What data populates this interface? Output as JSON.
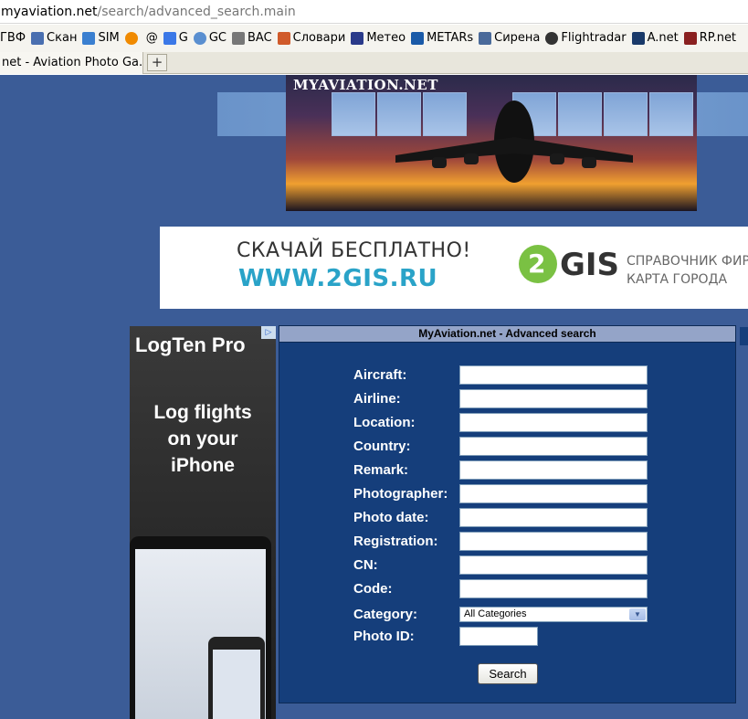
{
  "browser": {
    "url_host": "myaviation.net",
    "url_path": "/search/advanced_search.main",
    "bookmarks": [
      {
        "label": "ГВФ",
        "icon": "none",
        "color": "#ffffff"
      },
      {
        "label": "Скан",
        "icon": "eye-icon",
        "color": "#4a6fb0"
      },
      {
        "label": "SIM",
        "icon": "plane-icon",
        "color": "#3a7fd0"
      },
      {
        "label": "",
        "icon": "orange-circle-icon",
        "color": "#f08a00"
      },
      {
        "label": "@",
        "icon": "none",
        "color": "#ffffff"
      },
      {
        "label": "G",
        "icon": "google-icon",
        "color": "#3b78e7"
      },
      {
        "label": "GC",
        "icon": "globe-icon",
        "color": "#5a8fd0"
      },
      {
        "label": "BAC",
        "icon": "plane-icon",
        "color": "#777777"
      },
      {
        "label": "Словари",
        "icon": "chart-icon",
        "color": "#d05a2a"
      },
      {
        "label": "Метео",
        "icon": "weather-icon",
        "color": "#2a3a8a"
      },
      {
        "label": "METARs",
        "icon": "noaa-icon",
        "color": "#1a5aa8"
      },
      {
        "label": "Сирена",
        "icon": "plane-icon",
        "color": "#4a6a9a"
      },
      {
        "label": "Flightradar",
        "icon": "radar-icon",
        "color": "#333333"
      },
      {
        "label": "A.net",
        "icon": "plane-icon",
        "color": "#1a3a6a"
      },
      {
        "label": "RP.net",
        "icon": "camera-icon",
        "color": "#8a2020"
      }
    ],
    "tab_title": "net - Aviation Photo Ga...",
    "new_tab_label": "+"
  },
  "banner": {
    "title": "MYAVIATION.NET"
  },
  "ad_2gis": {
    "line1": "СКАЧАЙ БЕСПЛАТНО!",
    "line2": "WWW.2GIS.RU",
    "logo_digit": "2",
    "logo_text": "GIS",
    "desc1": "СПРАВОЧНИК ФИР",
    "desc2": "КАРТА ГОРОДА"
  },
  "ad_logten": {
    "brand": "LogTen Pro",
    "tagline1": "Log flights",
    "tagline2": "on your",
    "tagline3": "iPhone"
  },
  "form": {
    "heading": "MyAviation.net - Advanced search",
    "fields": [
      {
        "label": "Aircraft:",
        "value": ""
      },
      {
        "label": "Airline:",
        "value": ""
      },
      {
        "label": "Location:",
        "value": ""
      },
      {
        "label": "Country:",
        "value": ""
      },
      {
        "label": "Remark:",
        "value": ""
      },
      {
        "label": "Photographer:",
        "value": ""
      },
      {
        "label": "Photo date:",
        "value": ""
      },
      {
        "label": "Registration:",
        "value": ""
      },
      {
        "label": "CN:",
        "value": ""
      },
      {
        "label": "Code:",
        "value": ""
      }
    ],
    "category_label": "Category:",
    "category_value": "All Categories",
    "photo_id_label": "Photo ID:",
    "photo_id_value": "",
    "search_button": "Search"
  },
  "colors": {
    "page_bg": "#3b5c97",
    "form_bg": "#153e7b",
    "form_head_bg": "#94a4c8"
  }
}
